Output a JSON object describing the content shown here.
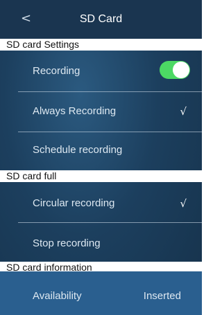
{
  "header": {
    "back_glyph": "<",
    "title": "SD Card",
    "back_icon": "chevron-left-icon"
  },
  "sections": {
    "settings": "SD card Settings",
    "full": "SD card full",
    "information": "SD card information"
  },
  "settings": {
    "recording_label": "Recording",
    "recording_on": true,
    "always_label": "Always Recording",
    "always_checked": true,
    "schedule_label": "Schedule recording"
  },
  "full": {
    "circular_label": "Circular recording",
    "circular_checked": true,
    "stop_label": "Stop recording"
  },
  "info": {
    "availability_label": "Availability",
    "availability_value": "Inserted"
  },
  "glyphs": {
    "check": "√"
  },
  "colors": {
    "toggle_on": "#4cd964",
    "section_bg": "#ffffff",
    "header_bg": "#1a3550"
  }
}
